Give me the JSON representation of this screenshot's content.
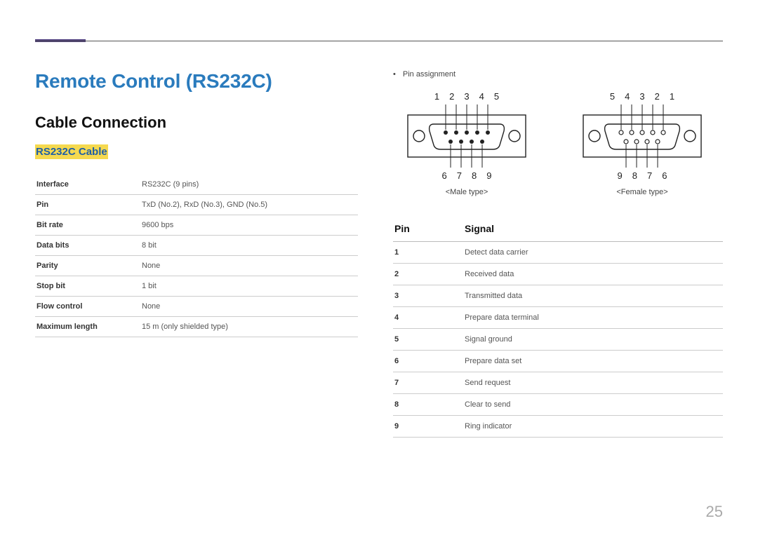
{
  "page_number": "25",
  "title": "Remote Control (RS232C)",
  "subtitle": "Cable Connection",
  "cable_heading": "RS232C Cable",
  "spec_rows": [
    {
      "label": "Interface",
      "value": "RS232C (9 pins)"
    },
    {
      "label": "Pin",
      "value": "TxD (No.2), RxD (No.3), GND (No.5)"
    },
    {
      "label": "Bit rate",
      "value": "9600 bps"
    },
    {
      "label": "Data bits",
      "value": "8 bit"
    },
    {
      "label": "Parity",
      "value": "None"
    },
    {
      "label": "Stop bit",
      "value": "1 bit"
    },
    {
      "label": "Flow control",
      "value": "None"
    },
    {
      "label": "Maximum length",
      "value": "15 m (only shielded type)"
    }
  ],
  "bullet": "Pin assignment",
  "male": {
    "top_pins": [
      "1",
      "2",
      "3",
      "4",
      "5"
    ],
    "bottom_pins": [
      "6",
      "7",
      "8",
      "9"
    ],
    "caption": "<Male type>"
  },
  "female": {
    "top_pins": [
      "5",
      "4",
      "3",
      "2",
      "1"
    ],
    "bottom_pins": [
      "9",
      "8",
      "7",
      "6"
    ],
    "caption": "<Female type>"
  },
  "signal_header": {
    "pin": "Pin",
    "signal": "Signal"
  },
  "signal_rows": [
    {
      "pin": "1",
      "signal": "Detect data carrier"
    },
    {
      "pin": "2",
      "signal": "Received data"
    },
    {
      "pin": "3",
      "signal": "Transmitted data"
    },
    {
      "pin": "4",
      "signal": "Prepare data terminal"
    },
    {
      "pin": "5",
      "signal": "Signal ground"
    },
    {
      "pin": "6",
      "signal": "Prepare data set"
    },
    {
      "pin": "7",
      "signal": "Send request"
    },
    {
      "pin": "8",
      "signal": "Clear to send"
    },
    {
      "pin": "9",
      "signal": "Ring indicator"
    }
  ]
}
